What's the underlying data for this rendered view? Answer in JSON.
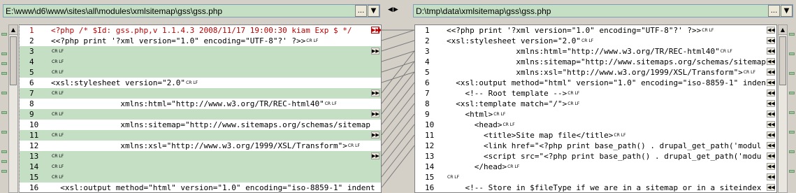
{
  "left": {
    "path": "E:\\www\\d6\\www\\sites\\all\\modules\\xmlsitemap\\gss\\gss.php",
    "browse_label": "...",
    "dropdown_label": "▼",
    "lines": [
      {
        "n": "1",
        "code": "<?php /* $Id: gss.php,v 1.1.4.3 2008/11/17 19:00:30 kiam Exp $ */",
        "crlf": false,
        "type": "current",
        "mark": "▶▶"
      },
      {
        "n": "2",
        "code": "<<?php print '?xml version=\"1.0\" encoding=\"UTF-8\"?' ?>>",
        "crlf": true,
        "type": "normal",
        "mark": ""
      },
      {
        "n": "3",
        "code": "",
        "crlf": true,
        "type": "diff",
        "mark": "▶▶"
      },
      {
        "n": "4",
        "code": "",
        "crlf": true,
        "type": "diff",
        "mark": ""
      },
      {
        "n": "5",
        "code": "",
        "crlf": true,
        "type": "diff",
        "mark": ""
      },
      {
        "n": "6",
        "code": "<xsl:stylesheet version=\"2.0\"",
        "crlf": true,
        "type": "normal",
        "mark": ""
      },
      {
        "n": "7",
        "code": "",
        "crlf": true,
        "type": "diff",
        "mark": "▶▶"
      },
      {
        "n": "8",
        "code": "               xmlns:html=\"http://www.w3.org/TR/REC-html40\"",
        "crlf": true,
        "type": "normal",
        "mark": ""
      },
      {
        "n": "9",
        "code": "",
        "crlf": true,
        "type": "diff",
        "mark": "▶▶"
      },
      {
        "n": "10",
        "code": "               xmlns:sitemap=\"http://www.sitemaps.org/schemas/sitemap",
        "crlf": false,
        "type": "normal",
        "mark": ""
      },
      {
        "n": "11",
        "code": "",
        "crlf": true,
        "type": "diff",
        "mark": "▶▶"
      },
      {
        "n": "12",
        "code": "               xmlns:xsl=\"http://www.w3.org/1999/XSL/Transform\">",
        "crlf": true,
        "type": "normal",
        "mark": ""
      },
      {
        "n": "13",
        "code": "",
        "crlf": true,
        "type": "diff",
        "mark": "▶▶"
      },
      {
        "n": "14",
        "code": "",
        "crlf": true,
        "type": "diff",
        "mark": ""
      },
      {
        "n": "15",
        "code": "",
        "crlf": true,
        "type": "diff",
        "mark": ""
      },
      {
        "n": "16",
        "code": "  <xsl:output method=\"html\" version=\"1.0\" encoding=\"iso-8859-1\" indent",
        "crlf": false,
        "type": "normal",
        "mark": ""
      }
    ]
  },
  "right": {
    "path": "D:\\tmp\\data\\xmlsitemap\\gss\\gss.php",
    "browse_label": "...",
    "dropdown_label": "▼",
    "lines": [
      {
        "n": "1",
        "code": "<<?php print '?xml version=\"1.0\" encoding=\"UTF-8\"?' ?>>",
        "crlf": true,
        "type": "normal",
        "mark": "◀◀"
      },
      {
        "n": "2",
        "code": "<xsl:stylesheet version=\"2.0\"",
        "crlf": true,
        "type": "normal",
        "mark": "◀◀"
      },
      {
        "n": "3",
        "code": "               xmlns:html=\"http://www.w3.org/TR/REC-html40\"",
        "crlf": true,
        "type": "normal",
        "mark": "◀◀"
      },
      {
        "n": "4",
        "code": "               xmlns:sitemap=\"http://www.sitemaps.org/schemas/sitemap",
        "crlf": false,
        "type": "normal",
        "mark": "◀◀"
      },
      {
        "n": "5",
        "code": "               xmlns:xsl=\"http://www.w3.org/1999/XSL/Transform\">",
        "crlf": true,
        "type": "normal",
        "mark": "◀◀"
      },
      {
        "n": "6",
        "code": "  <xsl:output method=\"html\" version=\"1.0\" encoding=\"iso-8859-1\" inden",
        "crlf": false,
        "type": "normal",
        "mark": "◀◀"
      },
      {
        "n": "7",
        "code": "    <!-- Root template -->",
        "crlf": true,
        "type": "normal",
        "mark": "◀◀"
      },
      {
        "n": "8",
        "code": "  <xsl:template match=\"/\">",
        "crlf": true,
        "type": "normal",
        "mark": "◀◀"
      },
      {
        "n": "9",
        "code": "    <html>",
        "crlf": true,
        "type": "normal",
        "mark": "◀◀"
      },
      {
        "n": "10",
        "code": "      <head>",
        "crlf": true,
        "type": "normal",
        "mark": "◀◀"
      },
      {
        "n": "11",
        "code": "        <title>Site map file</title>",
        "crlf": true,
        "type": "normal",
        "mark": "◀◀"
      },
      {
        "n": "12",
        "code": "        <link href=\"<?php print base_path() . drupal_get_path('modul",
        "crlf": false,
        "type": "normal",
        "mark": "◀◀"
      },
      {
        "n": "13",
        "code": "        <script src=\"<?php print base_path() . drupal_get_path('modu",
        "crlf": false,
        "type": "normal",
        "mark": "◀◀"
      },
      {
        "n": "14",
        "code": "      </head>",
        "crlf": true,
        "type": "normal",
        "mark": "◀◀"
      },
      {
        "n": "15",
        "code": "",
        "crlf": true,
        "type": "normal",
        "mark": "◀◀"
      },
      {
        "n": "16",
        "code": "    <!-- Store in $fileType if we are in a sitemap or in a siteindex",
        "crlf": false,
        "type": "normal",
        "mark": "◀◀"
      }
    ]
  },
  "crlf_label": "CR LF",
  "swap_label": "◀▶",
  "scroll_up": "▲",
  "colors": {
    "diff_bg": "#c5dfc5",
    "current_fg": "#c00000"
  }
}
